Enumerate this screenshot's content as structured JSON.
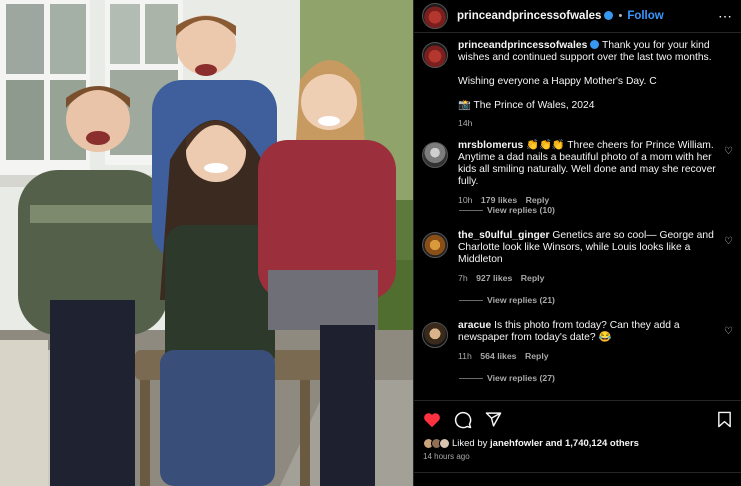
{
  "post": {
    "username": "princeandprincessofwales",
    "follow_label": "Follow",
    "more_icon": "more-options-icon",
    "dot": "•"
  },
  "caption": {
    "username": "princeandprincessofwales",
    "line1": "Thank you for your kind wishes and continued support over the last two months.",
    "line2": "Wishing everyone a Happy Mother's Day. C",
    "line3": "📸 The Prince of Wales, 2024",
    "time": "14h"
  },
  "comments": [
    {
      "username": "mrsblomerus",
      "text": "👏👏👏 Three cheers for Prince William. Anytime a dad nails a beautiful photo of a mom with her kids all smiling naturally. Well done and may she recover fully.",
      "time": "10h",
      "likes": "179 likes",
      "reply": "Reply",
      "view_replies": "View replies (10)"
    },
    {
      "username": "the_s0ulful_ginger",
      "text": "Genetics are so cool— George and Charlotte look like Winsors, while Louis looks like a Middleton",
      "time": "7h",
      "likes": "927 likes",
      "reply": "Reply",
      "view_replies": "View replies (21)"
    },
    {
      "username": "aracue",
      "text": "Is this photo from today? Can they add a newspaper from today's date? 😂",
      "time": "11h",
      "likes": "564 likes",
      "reply": "Reply",
      "view_replies": "View replies (27)"
    }
  ],
  "footer": {
    "liked_by_prefix": "Liked by",
    "liked_by_user": "janehfowler",
    "liked_by_suffix": "and 1,740,124 others",
    "timestamp": "14 hours ago"
  },
  "colors": {
    "accent": "#3b97ff",
    "like_red": "#ff3040",
    "verified": "#3897f0"
  }
}
